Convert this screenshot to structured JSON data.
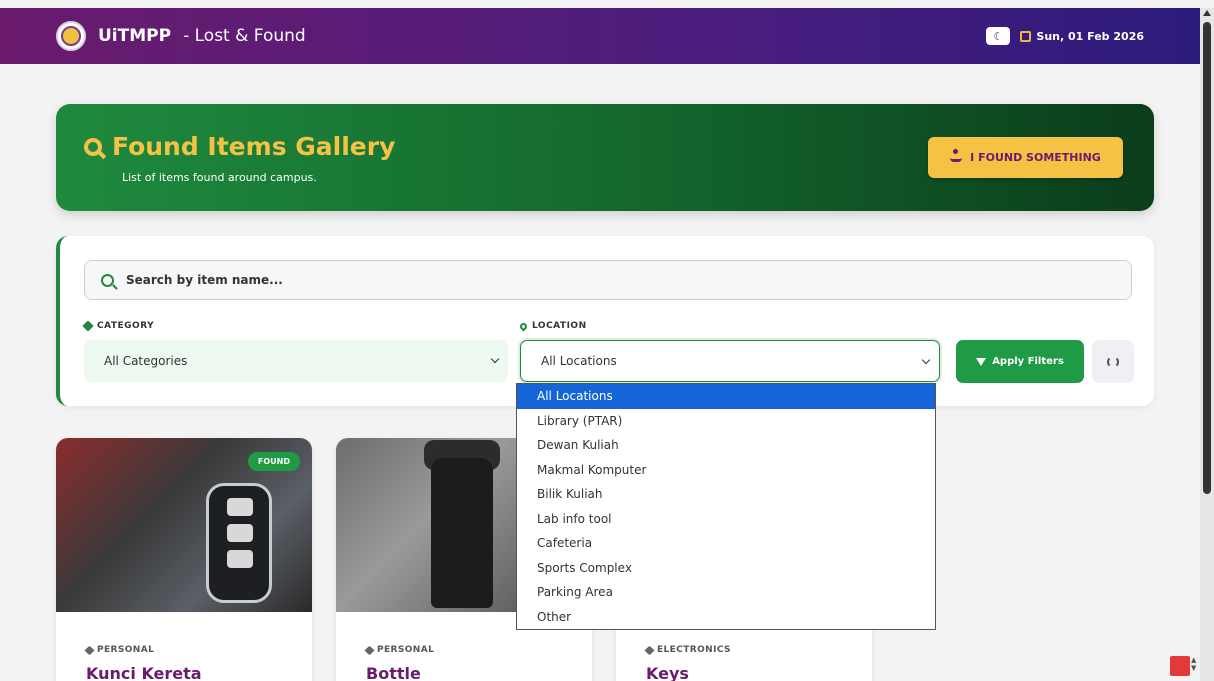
{
  "navbar": {
    "brand_name": "UiTMPP",
    "brand_sub": " - Lost & Found",
    "theme_toggle": "☾",
    "date": "Sun, 01 Feb 2026"
  },
  "hero": {
    "title": "Found Items Gallery",
    "subtitle": "List of items found around campus.",
    "found_button": "I FOUND SOMETHING"
  },
  "filters": {
    "search_placeholder": "Search by item name...",
    "category_label": "CATEGORY",
    "category_value": "All Categories",
    "location_label": "LOCATION",
    "location_value": "All Locations",
    "apply_label": "Apply Filters"
  },
  "location_options": [
    "All Locations",
    "Library (PTAR)",
    "Dewan Kuliah",
    "Makmal Komputer",
    "Bilik Kuliah",
    "Lab info tool",
    "Cafeteria",
    "Sports Complex",
    "Parking Area",
    "Other"
  ],
  "cards": [
    {
      "category": "PERSONAL",
      "title": "Kunci Kereta",
      "badge": "FOUND"
    },
    {
      "category": "PERSONAL",
      "title": "Bottle"
    },
    {
      "category": "ELECTRONICS",
      "title": "Keys"
    }
  ],
  "colors": {
    "brand_purple": "#6a1b6e",
    "accent_green": "#1f8a3e",
    "accent_gold": "#f6c244",
    "selected_blue": "#1565d8"
  }
}
